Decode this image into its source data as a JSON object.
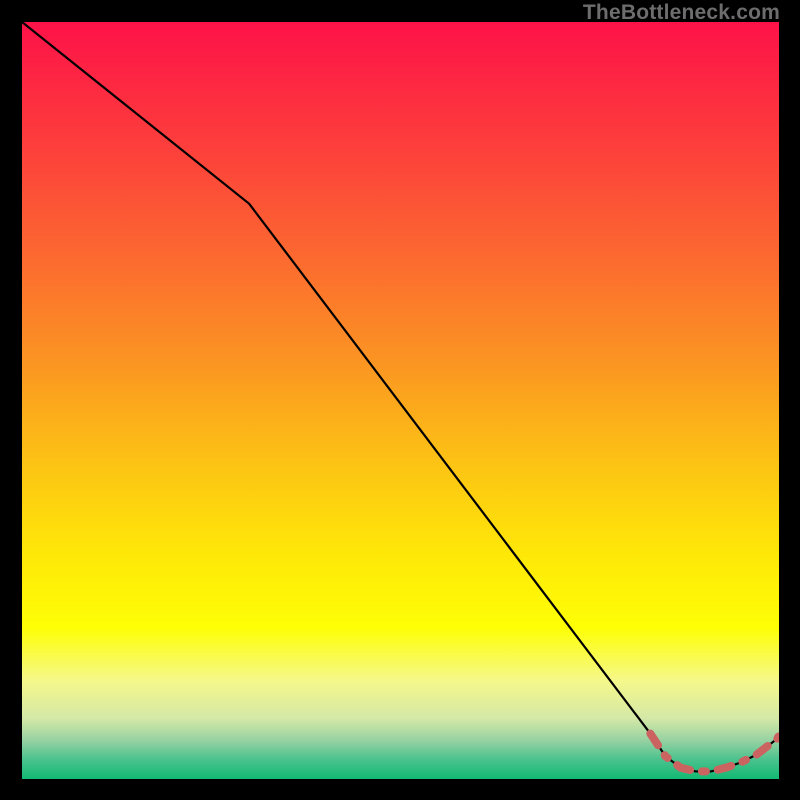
{
  "watermark": "TheBottleneck.com",
  "chart_data": {
    "type": "line",
    "title": "",
    "xlabel": "",
    "ylabel": "",
    "xlim": [
      0,
      100
    ],
    "ylim": [
      0,
      100
    ],
    "grid": false,
    "legend": false,
    "series": [
      {
        "name": "bottleneck-curve",
        "style": "solid-black",
        "x": [
          0,
          30,
          83,
          85,
          87,
          89,
          91,
          93,
          95,
          97,
          100
        ],
        "values": [
          100,
          76,
          6,
          3,
          1.5,
          1,
          1,
          1.5,
          2.2,
          3.2,
          5.5
        ]
      },
      {
        "name": "highlight-dashed",
        "style": "dashed-red",
        "x": [
          83,
          85,
          87,
          89,
          91,
          93,
          95,
          97,
          100
        ],
        "values": [
          6,
          3,
          1.5,
          1,
          1,
          1.5,
          2.2,
          3.2,
          5.5
        ]
      }
    ],
    "background_gradient": {
      "stops": [
        {
          "offset": 0.0,
          "color": "#fd1248"
        },
        {
          "offset": 0.16,
          "color": "#fd3d3c"
        },
        {
          "offset": 0.3,
          "color": "#fc6631"
        },
        {
          "offset": 0.45,
          "color": "#fb9522"
        },
        {
          "offset": 0.58,
          "color": "#fcc214"
        },
        {
          "offset": 0.7,
          "color": "#fee708"
        },
        {
          "offset": 0.8,
          "color": "#feff05"
        },
        {
          "offset": 0.87,
          "color": "#f5f88a"
        },
        {
          "offset": 0.92,
          "color": "#d4e8a7"
        },
        {
          "offset": 0.95,
          "color": "#94d1a2"
        },
        {
          "offset": 0.975,
          "color": "#49c28d"
        },
        {
          "offset": 1.0,
          "color": "#12b973"
        }
      ]
    }
  }
}
